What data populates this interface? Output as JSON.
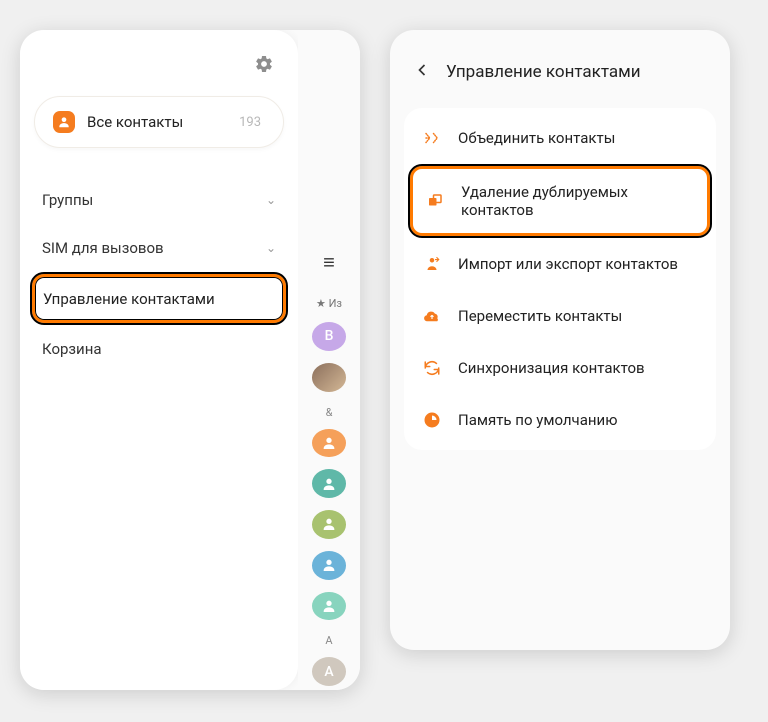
{
  "left": {
    "all_contacts_label": "Все контакты",
    "all_contacts_count": "193",
    "menu": {
      "groups": "Группы",
      "sim": "SIM для вызовов",
      "manage": "Управление контактами",
      "trash": "Корзина"
    },
    "peek": {
      "fav_label": "Из",
      "avatar_b": "B",
      "section_amp": "&",
      "section_a": "A",
      "avatar_a": "A"
    }
  },
  "right": {
    "header_title": "Управление контактами",
    "options": {
      "merge": "Объединить контакты",
      "remove_dup": "Удаление дублируемых контактов",
      "import_export": "Импорт или экспорт контактов",
      "move": "Переместить контакты",
      "sync": "Синхронизация контактов",
      "default_storage": "Память по умолчанию"
    }
  }
}
